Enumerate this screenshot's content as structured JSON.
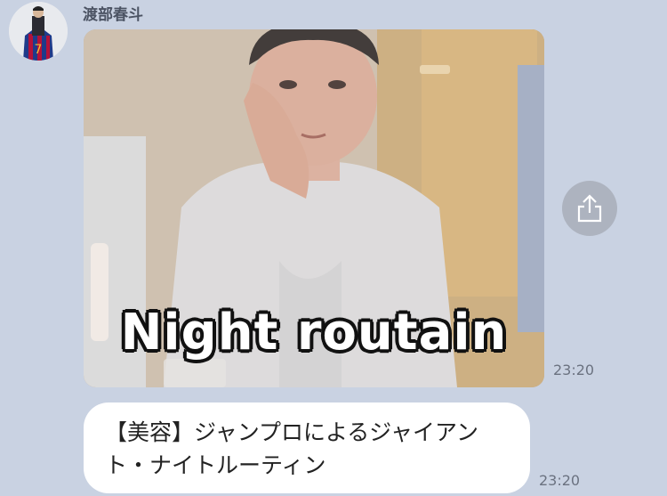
{
  "message": {
    "sender_name": "渡部春斗",
    "image_caption_text": "Night routain",
    "image_time": "23:20",
    "text": "【美容】ジャンプロによるジャイアント・ナイトルーティン",
    "text_time": "23:20"
  },
  "icons": {
    "share": "share-icon",
    "avatar": "avatar"
  },
  "colors": {
    "background": "#c9d2e2",
    "bubble": "#ffffff",
    "share_button": "#adb3bf"
  }
}
